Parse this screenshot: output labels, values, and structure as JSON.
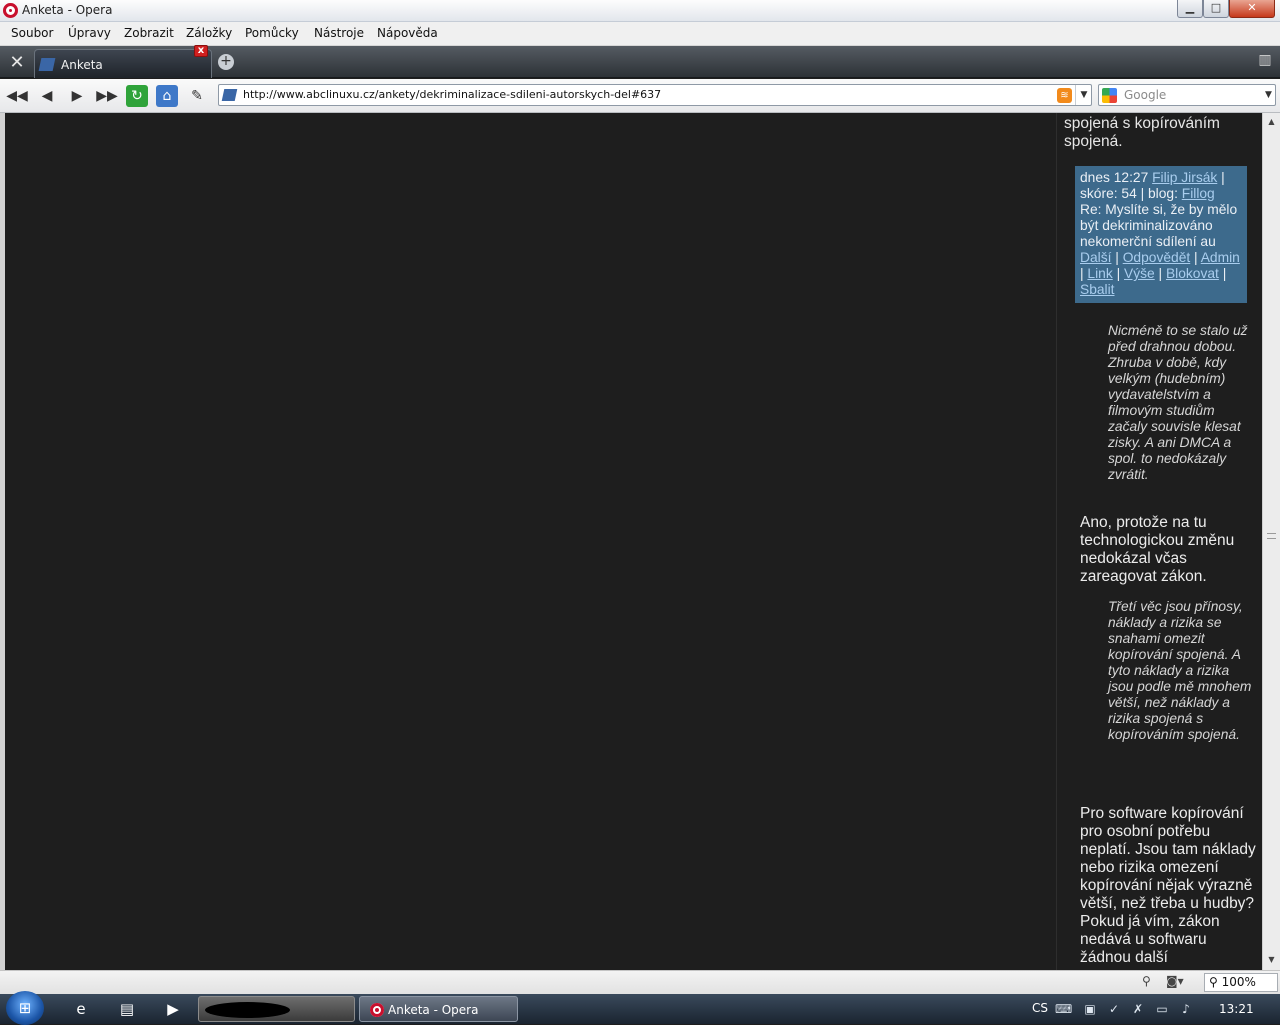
{
  "window": {
    "title": "Anketa - Opera",
    "minimize_glyph": "▁",
    "maximize_glyph": "□",
    "close_glyph": "✕"
  },
  "menu": [
    "Soubor",
    "Úpravy",
    "Zobrazit",
    "Záložky",
    "Pomůcky",
    "Nástroje",
    "Nápověda"
  ],
  "tabs": {
    "active_label": "Anketa",
    "close_glyph": "x",
    "newtab_glyph": "+"
  },
  "nav": {
    "url": "http://www.abclinuxu.cz/ankety/dekriminalizace-sdileni-autorskych-del#637",
    "search_placeholder": "Google",
    "rss_glyph": "≋",
    "dropdown_glyph": "▼"
  },
  "content": {
    "intro_text": "spojená s kopírováním spojená.",
    "comment_header": {
      "time": "dnes 12:27",
      "author": "Filip Jirsák",
      "score_prefix": "skóre: 54 | blog:",
      "blog": "Fillog",
      "subject": "Re: Myslíte si, že by mělo být dekriminalizováno nekomerční sdílení au",
      "links": {
        "next": "Další",
        "reply": "Odpovědět",
        "admin": "Admin",
        "link": "Link",
        "up": "Výše",
        "block": "Blokovat",
        "collapse": "Sbalit"
      }
    },
    "quote1": "Nicméně to se stalo už před drahnou dobou. Zhruba v době, kdy velkým (hudebním) vydavatelstvím a filmovým studiům začaly souvisle klesat zisky. A ani DMCA a spol. to nedokázaly zvrátit.",
    "para1": "Ano, protože na tu technologickou změnu nedokázal včas zareagovat zákon.",
    "quote2": "Třetí věc jsou přínosy, náklady a rizika se snahami omezit kopírování spojená. A tyto náklady a rizika jsou podle mě mnohem větší, než náklady a rizika spojená s kopírováním spojená.",
    "para2": "Pro software kopírování pro osobní potřebu neplatí. Jsou tam náklady nebo rizika omezení kopírování nějak výrazně větší, než třeba u hudby? Pokud já vím, zákon nedává u softwaru žádnou další"
  },
  "statusbar": {
    "zoom": "100%"
  },
  "taskbar": {
    "window_label": "Anketa - Opera",
    "lang": "CS",
    "clock": "13:21"
  }
}
